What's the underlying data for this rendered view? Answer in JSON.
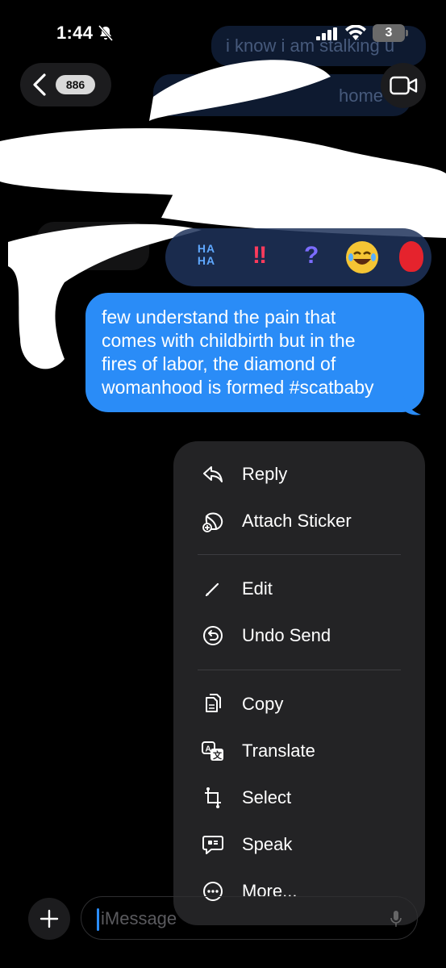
{
  "status_bar": {
    "time": "1:44",
    "battery": "3"
  },
  "nav": {
    "back_count": "886"
  },
  "background": {
    "ghost_1": "i know i am stalking u",
    "ghost_2": "home"
  },
  "reactions": {
    "haha": "HA\nHA",
    "exclamation": "‼",
    "question": "?",
    "items": [
      "haha",
      "exclamation",
      "question",
      "laugh-emoji",
      "balloon-emoji"
    ]
  },
  "message": {
    "text": "few understand the pain that\ncomes with childbirth but in the\nfires of labor, the diamond of\nwomanhood is formed #scatbaby",
    "bubble_color": "#2a8cf7"
  },
  "context_menu": {
    "reply": "Reply",
    "attach_sticker": "Attach Sticker",
    "edit": "Edit",
    "undo_send": "Undo Send",
    "copy": "Copy",
    "translate": "Translate",
    "select": "Select",
    "speak": "Speak",
    "more": "More..."
  },
  "input": {
    "placeholder": "iMessage"
  }
}
